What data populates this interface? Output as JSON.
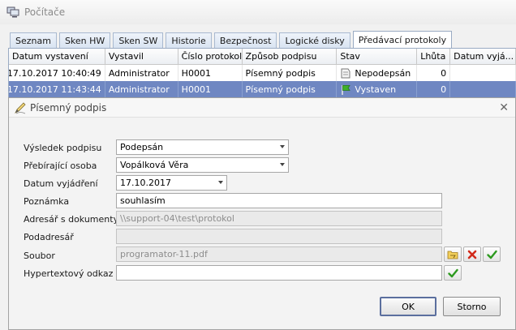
{
  "window": {
    "title": "Počítače",
    "icon": "computers-icon"
  },
  "tabs": [
    {
      "label": "Seznam"
    },
    {
      "label": "Sken HW"
    },
    {
      "label": "Sken SW"
    },
    {
      "label": "Historie"
    },
    {
      "label": "Bezpečnost"
    },
    {
      "label": "Logické disky"
    },
    {
      "label": "Předávací protokoly",
      "active": true
    }
  ],
  "grid": {
    "columns": [
      "Datum vystavení",
      "Vystavil",
      "Číslo protokolu",
      "Způsob podpisu",
      "Stav",
      "Lhůta",
      "Datum vyjá..."
    ],
    "rows": [
      {
        "datum": "17.10.2017 10:40:49",
        "vystavil": "Administrator",
        "cislo": "H0001",
        "zpusob": "Písemný podpis",
        "stav": "Nepodepsán",
        "stav_icon": "document-icon",
        "lhuta": "0",
        "datum_vyj": ""
      },
      {
        "datum": "17.10.2017 11:43:44",
        "vystavil": "Administrator",
        "cislo": "H0001",
        "zpusob": "Písemný podpis",
        "stav": "Vystaven",
        "stav_icon": "green-flag-icon",
        "lhuta": "0",
        "datum_vyj": "",
        "selected": true
      }
    ]
  },
  "dialog": {
    "title": "Písemný podpis",
    "fields": {
      "vysledek": {
        "label": "Výsledek podpisu",
        "value": "Podepsán"
      },
      "osoba": {
        "label": "Přebírající osoba",
        "value": "Vopálková Věra"
      },
      "datum": {
        "label": "Datum vyjádření",
        "value": "17.10.2017"
      },
      "poznamka": {
        "label": "Poznámka",
        "value": "souhlasím"
      },
      "adresar": {
        "label": "Adresář s dokumenty",
        "value": "\\\\support-04\\test\\protokol"
      },
      "podadresar": {
        "label": "Podadresář",
        "value": ""
      },
      "soubor": {
        "label": "Soubor",
        "value": "programator-11.pdf"
      },
      "odkaz": {
        "label": "Hypertextový odkaz",
        "value": ""
      }
    },
    "buttons": {
      "ok": "OK",
      "cancel": "Storno"
    }
  },
  "colors": {
    "selection": "#6f87c2",
    "accent_border": "#9aabc3"
  }
}
